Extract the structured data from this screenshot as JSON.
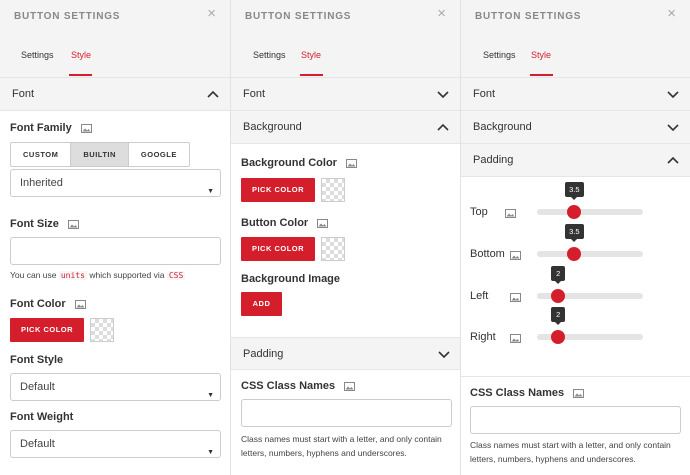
{
  "panel_title": "BUTTON SETTINGS",
  "close_glyph": "×",
  "tabs": {
    "settings": "Settings",
    "style": "Style"
  },
  "accent_color": "#d41e2c",
  "panel1": {
    "section_font": "Font",
    "font_family_label": "Font Family",
    "font_family_options": [
      "CUSTOM",
      "BUILTIN",
      "GOOGLE"
    ],
    "font_family_selected": "BUILTIN",
    "font_select_value": "Inherited",
    "font_size_label": "Font Size",
    "font_size_value": "",
    "help_prefix": "You can use",
    "help_units": "units",
    "help_middle": "which supported via",
    "help_css": "CSS",
    "font_color_label": "Font Color",
    "pick_color": "PICK COLOR",
    "font_style_label": "Font Style",
    "font_style_value": "Default",
    "font_weight_label": "Font Weight",
    "font_weight_value": "Default"
  },
  "panel2": {
    "section_font": "Font",
    "section_background": "Background",
    "bg_color_label": "Background Color",
    "pick_color": "PICK COLOR",
    "button_color_label": "Button Color",
    "bg_image_label": "Background Image",
    "add_label": "ADD",
    "section_padding": "Padding",
    "css_class_label": "CSS Class Names",
    "css_class_value": "",
    "css_help": "Class names must start with a letter, and only contain letters, numbers, hyphens and underscores."
  },
  "panel3": {
    "section_font": "Font",
    "section_background": "Background",
    "section_padding": "Padding",
    "padding": [
      {
        "label": "Top",
        "value": "3.5",
        "fraction": 0.35
      },
      {
        "label": "Bottom",
        "value": "3.5",
        "fraction": 0.35
      },
      {
        "label": "Left",
        "value": "2",
        "fraction": 0.2
      },
      {
        "label": "Right",
        "value": "2",
        "fraction": 0.2
      }
    ],
    "css_class_label": "CSS Class Names",
    "css_class_value": "",
    "css_help": "Class names must start with a letter, and only contain letters, numbers, hyphens and underscores."
  }
}
